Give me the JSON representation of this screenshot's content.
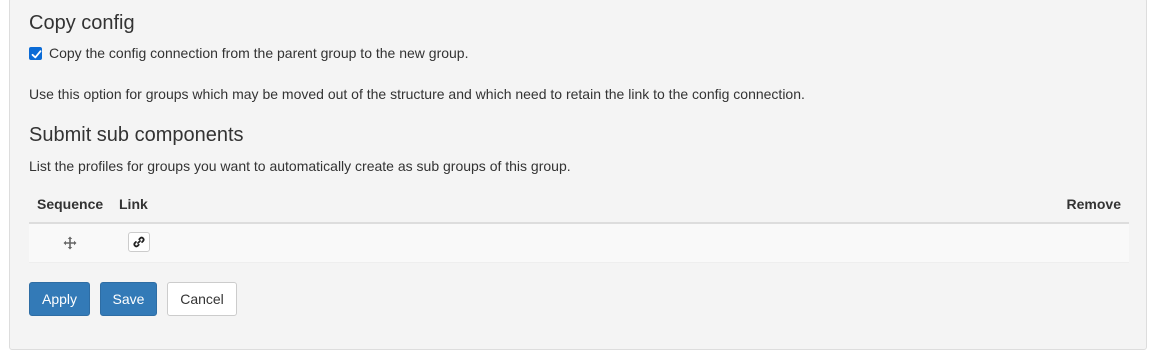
{
  "copy_config": {
    "heading": "Copy config",
    "checkbox_label": "Copy the config connection from the parent group to the new group.",
    "checkbox_checked": true,
    "help_text": "Use this option for groups which may be moved out of the structure and which need to retain the link to the config connection."
  },
  "sub_components": {
    "heading": "Submit sub components",
    "help_text": "List the profiles for groups you want to automatically create as sub groups of this group.",
    "columns": [
      "Sequence",
      "Link",
      "Remove"
    ],
    "rows": [
      {
        "sequence_icon": "move-icon",
        "link_icon": "link-icon"
      }
    ]
  },
  "actions": {
    "apply_label": "Apply",
    "save_label": "Save",
    "cancel_label": "Cancel"
  },
  "colors": {
    "primary": "#337ab7",
    "checkbox": "#0b6bd6",
    "panel_bg": "#f4f4f4"
  }
}
